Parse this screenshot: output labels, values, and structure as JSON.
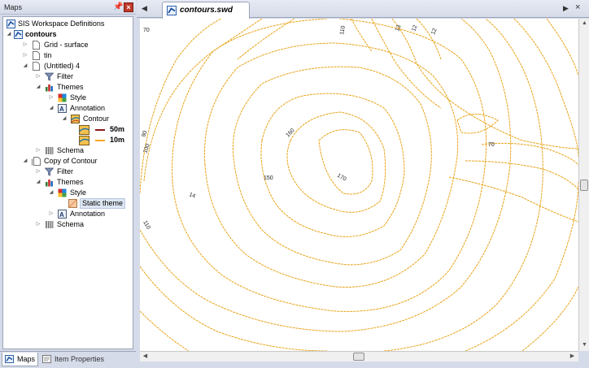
{
  "panel": {
    "title": "Maps"
  },
  "tree": {
    "root": "SIS Workspace Definitions",
    "items": [
      "contours",
      "Grid - surface",
      "tin",
      "(Untitled) 4",
      "Filter",
      "Themes",
      "Style",
      "Annotation",
      "Contour",
      "Schema",
      "Copy of Contour",
      "Filter",
      "Themes",
      "Style",
      "Static theme",
      "Annotation",
      "Schema"
    ],
    "legend": [
      {
        "label": "50m",
        "color": "#8b1a1a"
      },
      {
        "label": "10m",
        "color": "#f5a623"
      }
    ]
  },
  "bottom_tabs": [
    "Maps",
    "Item Properties"
  ],
  "document": {
    "tab_label": "contours.swd"
  },
  "map": {
    "contour_color": "#e8a317",
    "labels": [
      "70",
      "110",
      "13",
      "12",
      "12",
      "90",
      "100",
      "160",
      "150",
      "170",
      "14",
      "110",
      "70"
    ]
  }
}
